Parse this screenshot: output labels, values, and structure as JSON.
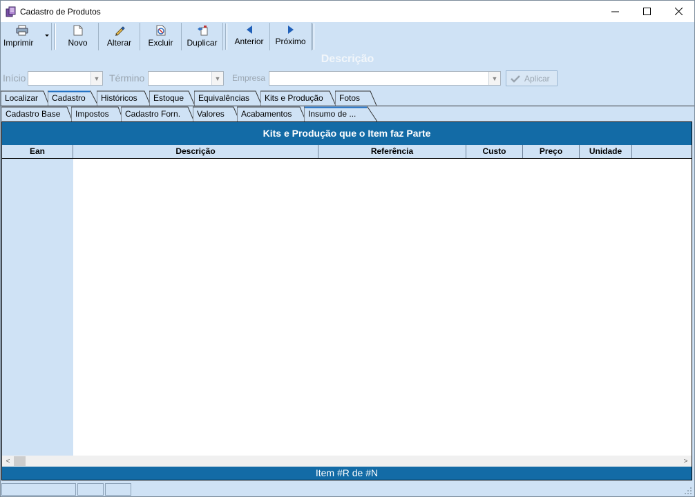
{
  "window": {
    "title": "Cadastro de Produtos"
  },
  "toolbar": {
    "print": "Imprimir",
    "new": "Novo",
    "edit": "Alterar",
    "delete": "Excluir",
    "duplicate": "Duplicar",
    "previous": "Anterior",
    "next": "Próximo"
  },
  "description": "Descrição",
  "filters": {
    "start_label": "Início",
    "end_label": "Término",
    "company_label": "Empresa",
    "apply_label": "Aplicar"
  },
  "main_tabs": [
    "Localizar",
    "Cadastro",
    "Históricos",
    "Estoque",
    "Equivalências",
    "Kits e Produção",
    "Fotos"
  ],
  "sub_tabs": [
    "Cadastro Base",
    "Impostos",
    "Cadastro Forn.",
    "Valores",
    "Acabamentos",
    "Insumo de ..."
  ],
  "grid": {
    "title": "Kits e Produção que o Item faz Parte",
    "columns": [
      "Ean",
      "Descrição",
      "Referência",
      "Custo",
      "Preço",
      "Unidade"
    ],
    "footer": "Item #R de #N"
  },
  "colors": {
    "accent": "#136ba6",
    "background": "#cfe2f5"
  },
  "icons": [
    "app-icon",
    "printer-icon",
    "new-doc-icon",
    "pencil-icon",
    "delete-doc-icon",
    "duplicate-icon",
    "arrow-left-icon",
    "arrow-right-icon",
    "check-icon"
  ]
}
